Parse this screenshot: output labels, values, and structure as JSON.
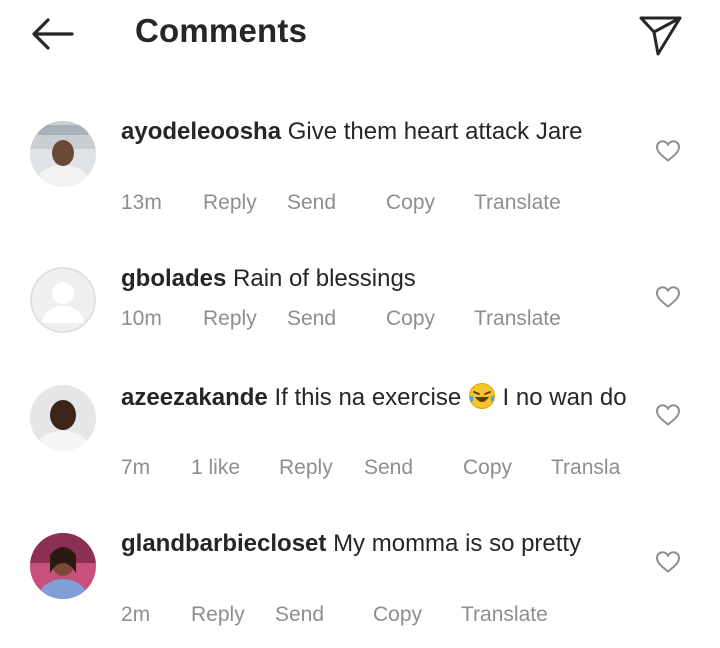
{
  "header": {
    "title": "Comments"
  },
  "comments": [
    {
      "username": "ayodeleoosha",
      "text": "Give them heart attack Jare",
      "time": "13m",
      "reply": "Reply",
      "send": "Send",
      "copy": "Copy",
      "translate": "Translate"
    },
    {
      "username": "gbolades",
      "text": "Rain of blessings",
      "time": "10m",
      "reply": "Reply",
      "send": "Send",
      "copy": "Copy",
      "translate": "Translate"
    },
    {
      "username": "azeezakande",
      "text_a": "If this na exercise",
      "text_b": "I no wan do",
      "emoji": "face-with-tears-of-joy",
      "time": "7m",
      "likes": "1 like",
      "reply": "Reply",
      "send": "Send",
      "copy": "Copy",
      "translate": "Transla"
    },
    {
      "username": "glandbarbiecloset",
      "text": "My momma is so pretty",
      "time": "2m",
      "reply": "Reply",
      "send": "Send",
      "copy": "Copy",
      "translate": "Translate"
    }
  ],
  "colors": {
    "primary_text": "#262626",
    "secondary_text": "#8e8e8e",
    "background": "#ffffff"
  }
}
